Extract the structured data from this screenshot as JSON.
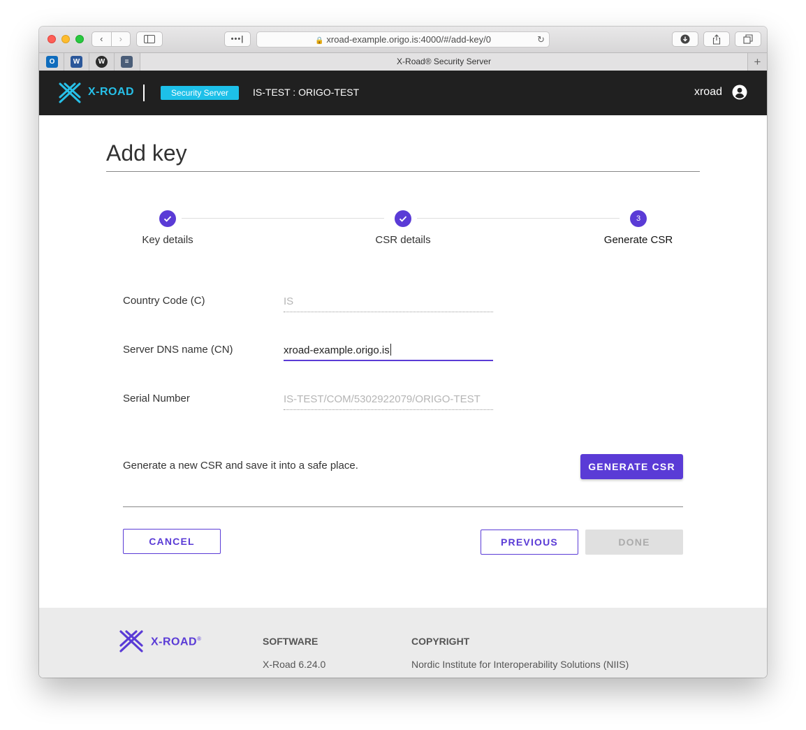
{
  "browser": {
    "url": "xroad-example.origo.is:4000/#/add-key/0",
    "tab_title": "X-Road® Security Server",
    "nav_back": "‹",
    "nav_forward": "›",
    "dots": "•••|",
    "plus": "+"
  },
  "header": {
    "brand": "X-ROAD",
    "badge": "Security Server",
    "server_id": "IS-TEST : ORIGO-TEST",
    "user": "xroad",
    "brand_color": "#27c0e8"
  },
  "page": {
    "title": "Add key"
  },
  "stepper": {
    "steps": [
      {
        "label": "Key details",
        "state": "complete"
      },
      {
        "label": "CSR details",
        "state": "complete"
      },
      {
        "label": "Generate CSR",
        "state": "active",
        "number": "3"
      }
    ],
    "accent_color": "#5a3bd6"
  },
  "form": {
    "fields": [
      {
        "label": "Country Code (C)",
        "value": "IS",
        "state": "disabled"
      },
      {
        "label": "Server DNS name (CN)",
        "value": "xroad-example.origo.is",
        "state": "focused"
      },
      {
        "label": "Serial Number",
        "value": "IS-TEST/COM/5302922079/ORIGO-TEST",
        "state": "disabled"
      }
    ]
  },
  "generate": {
    "hint": "Generate a new CSR and save it into a safe place.",
    "button": "GENERATE CSR"
  },
  "actions": {
    "cancel": "CANCEL",
    "previous": "PREVIOUS",
    "done": "DONE"
  },
  "footer": {
    "brand": "X-ROAD",
    "brand_mark": "®",
    "software_heading": "SOFTWARE",
    "software_version": "X-Road 6.24.0",
    "copyright_heading": "COPYRIGHT",
    "copyright_text": "Nordic Institute for Interoperability Solutions (NIIS)"
  }
}
